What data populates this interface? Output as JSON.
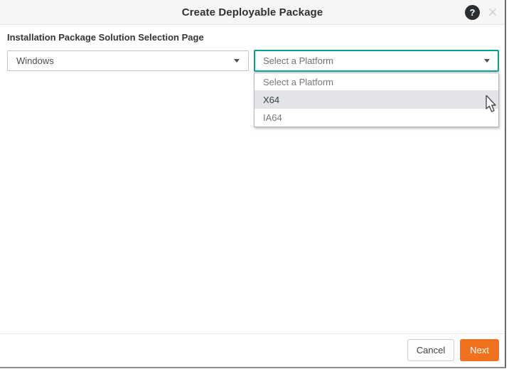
{
  "dialog": {
    "title": "Create Deployable Package",
    "help_icon_glyph": "?",
    "close_icon_glyph": "×"
  },
  "content": {
    "label": "Installation Package Solution Selection Page",
    "os_select": {
      "value": "Windows"
    },
    "platform_select": {
      "value": "Select a Platform",
      "options": [
        "Select a Platform",
        "X64",
        "IA64"
      ],
      "highlighted_option": "X64"
    }
  },
  "footer": {
    "cancel_label": "Cancel",
    "next_label": "Next"
  },
  "colors": {
    "accent_teal": "#00a095",
    "primary_orange": "#f2711c",
    "header_bg": "#f6f6f6",
    "hover_row_bg": "#e2e4e7",
    "help_icon_bg": "#2b2f33",
    "window_border": "#6a6a6a"
  }
}
